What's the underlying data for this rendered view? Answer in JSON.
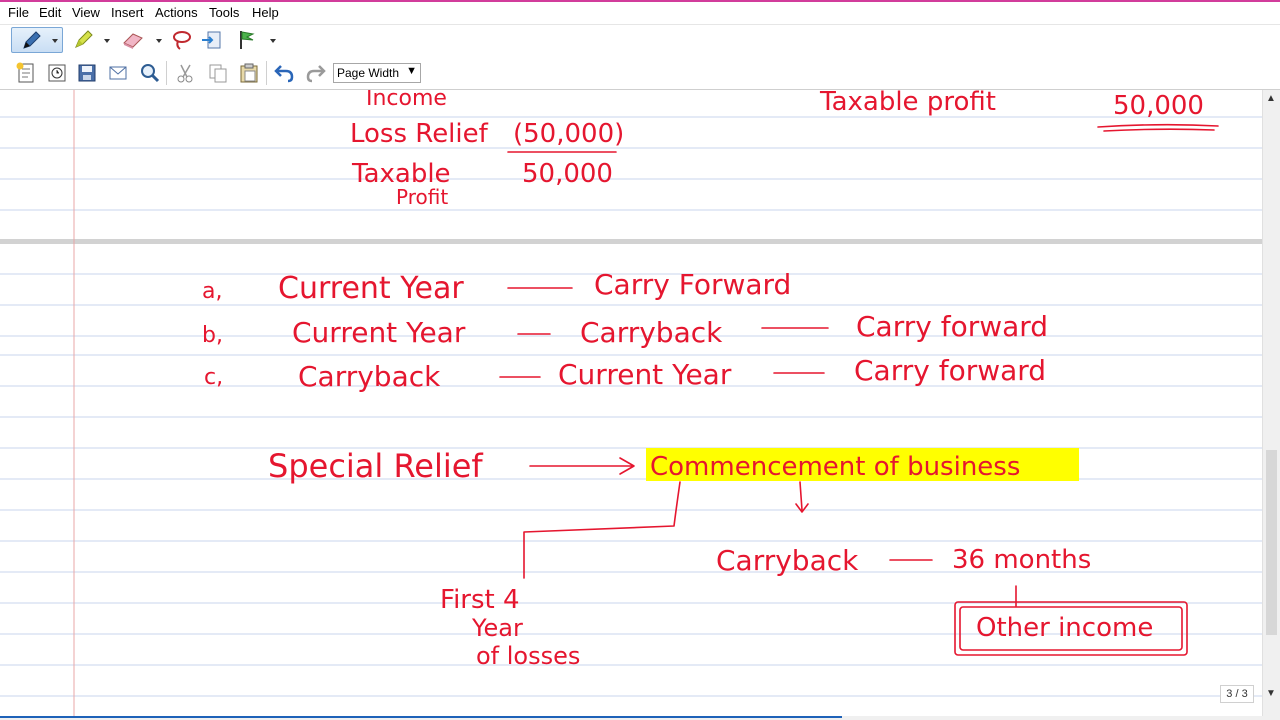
{
  "menu": [
    "File",
    "Edit",
    "View",
    "Insert",
    "Actions",
    "Tools",
    "Help"
  ],
  "toolbar": {
    "zoom_value": "Page Width",
    "tools_row1": [
      "pen-icon",
      "highlighter-icon",
      "eraser-icon",
      "lasso-icon",
      "insert-space-icon",
      "flag-icon"
    ],
    "tools_row2": [
      "new-page-icon",
      "date-time-icon",
      "save-icon",
      "send-icon",
      "zoom-icon",
      "cut-icon",
      "copy-icon",
      "paste-icon",
      "undo-icon",
      "redo-icon"
    ]
  },
  "page_indicator": "3 / 3",
  "colors": {
    "ink": "#e5162f",
    "highlight": "#ffff00",
    "rule_lines": "#c8d6ee",
    "margin_line": "#e8a7a7",
    "accent": "#d23c9b"
  },
  "notes": {
    "top_left": {
      "line1": "Income",
      "line2": "Loss Relief",
      "line2_value": "(50,000)",
      "line3": "Taxable",
      "line3_value": "50,000",
      "line4": "Profit"
    },
    "top_right": {
      "label": "Taxable profit",
      "value": "50,000"
    },
    "options": [
      {
        "letter": "a,",
        "steps": [
          "Current Year",
          "Carry Forward"
        ]
      },
      {
        "letter": "b,",
        "steps": [
          "Current Year",
          "Carryback",
          "Carry forward"
        ]
      },
      {
        "letter": "c,",
        "steps": [
          "Carryback",
          "Current Year",
          "Carry forward"
        ]
      }
    ],
    "special_relief": "Special Relief",
    "commencement": "Commencement of business",
    "branch_left": [
      "First 4",
      "Year",
      "of losses"
    ],
    "carryback_36": "Carryback",
    "carryback_months": "36 months",
    "other_income": "Other income"
  }
}
